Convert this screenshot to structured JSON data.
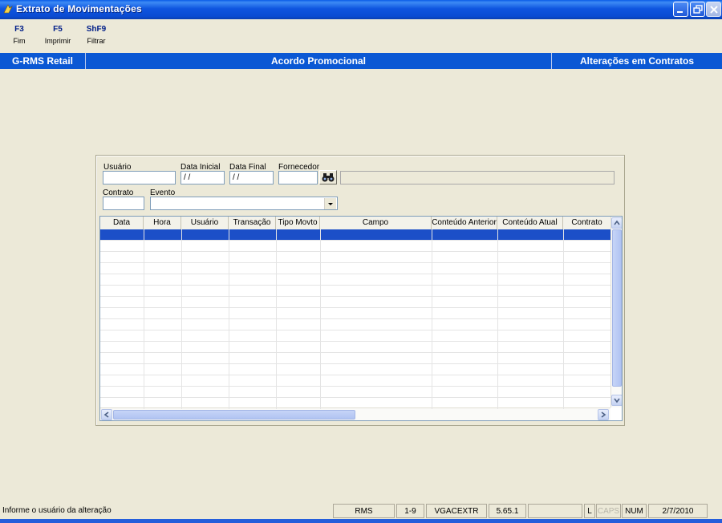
{
  "window": {
    "title": "Extrato de Movimentações",
    "buttons": [
      "minimize",
      "restore",
      "close"
    ]
  },
  "function_keys": [
    {
      "key": "F3",
      "label": "Fim"
    },
    {
      "key": "F5",
      "label": "Imprimir"
    },
    {
      "key": "ShF9",
      "label": "Filtrar"
    }
  ],
  "header": {
    "app": "G-RMS Retail",
    "module": "Acordo Promocional",
    "section": "Alterações em Contratos"
  },
  "filters": {
    "usuario_label": "Usuário",
    "usuario_value": "",
    "data_inicial_label": "Data Inicial",
    "data_inicial_value": "/ /",
    "data_final_label": "Data Final",
    "data_final_value": "/ /",
    "fornecedor_label": "Fornecedor",
    "fornecedor_code": "",
    "fornecedor_name": "",
    "contrato_label": "Contrato",
    "contrato_value": "",
    "evento_label": "Evento",
    "evento_value": ""
  },
  "table": {
    "columns": [
      "Data",
      "Hora",
      "Usuário",
      "Transação",
      "Tipo Movto",
      "Campo",
      "Conteúdo Anterior",
      "Conteúdo Atual",
      "Contrato"
    ],
    "rows": []
  },
  "status": {
    "message": "Informe o usuário da alteração",
    "system": "RMS",
    "range": "1-9",
    "program": "VGACEXTR",
    "version": "5.65.1",
    "indicator": "",
    "lock": "L",
    "caps": "CAPS",
    "num": "NUM",
    "date": "2/7/2010"
  },
  "colors": {
    "titlebar": "#0a4bd3",
    "header_bar": "#0b58d4",
    "selected_row": "#1c4fc8",
    "background": "#ece9d8"
  }
}
